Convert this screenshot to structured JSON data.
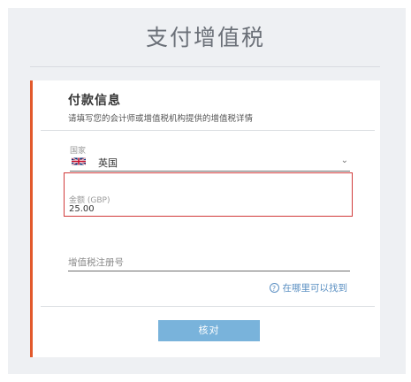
{
  "page": {
    "title": "支付增值税"
  },
  "payment_section": {
    "title": "付款信息",
    "subtitle": "请填写您的会计师或增值税机构提供的增值税详情"
  },
  "country": {
    "label": "国家",
    "value": "英国",
    "flag_icon": "uk-flag-icon"
  },
  "amount": {
    "label": "金额 (GBP)",
    "value": "25.00"
  },
  "vat_number": {
    "placeholder": "增值税注册号"
  },
  "help": {
    "label": "在哪里可以找到"
  },
  "actions": {
    "submit_label": "核对"
  },
  "colors": {
    "accent": "#e2592c",
    "button": "#79b3db",
    "link": "#5a8fc2",
    "error_border": "#d13b3b"
  }
}
